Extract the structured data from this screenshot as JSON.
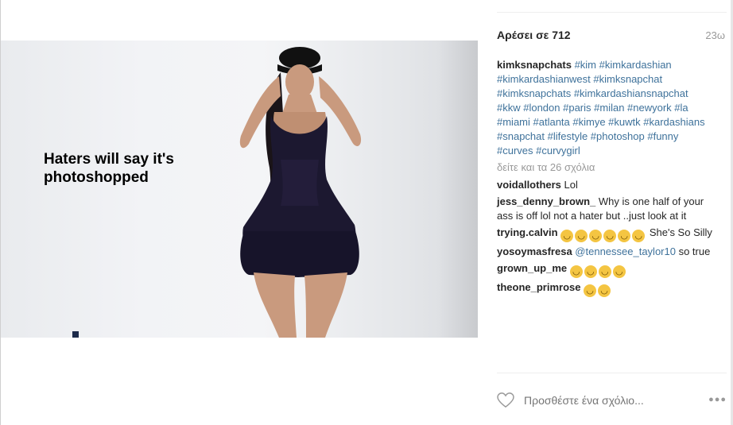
{
  "photo": {
    "caption": "Haters will say it's photoshopped"
  },
  "header": {
    "likes": "Αρέσει σε 712",
    "time": "23ω"
  },
  "description": {
    "user": "kimksnapchats",
    "hashtags": "#kim #kimkardashian #kimkardashianwest #kimksnapchat #kimksnapchats #kimkardashiansnapchat #kkw #london #paris #milan #newyork #la #miami #atlanta #kimye #kuwtk #kardashians #snapchat #lifestyle #photoshop #funny #curves #curvygirl"
  },
  "more_comments": "δείτε και τα 26 σχόλια",
  "comments": [
    {
      "user": "voidallothers",
      "text": "Lol",
      "emoji_count": 0
    },
    {
      "user": "jess_denny_brown_",
      "text": "Why is one half of your ass is off lol not a hater but ..just look at it",
      "emoji_count": 0
    },
    {
      "user": "trying.calvin",
      "text": "She's So Silly",
      "emoji_count": 6
    },
    {
      "user": "yosoymasfresa",
      "mention": "@tennessee_taylor10",
      "text": "so true",
      "emoji_count": 0
    },
    {
      "user": "grown_up_me",
      "text": "",
      "emoji_count": 4
    },
    {
      "user": "theone_primrose",
      "text": "",
      "emoji_count": 2
    }
  ],
  "add_comment": {
    "placeholder": "Προσθέστε ένα σχόλιο..."
  },
  "icons": {
    "like": "heart-icon",
    "options": "more-options-icon",
    "emoji": "laughing-emoji-icon"
  },
  "colors": {
    "hashtag": "#3f729b",
    "text": "#262626",
    "muted": "#999999"
  }
}
